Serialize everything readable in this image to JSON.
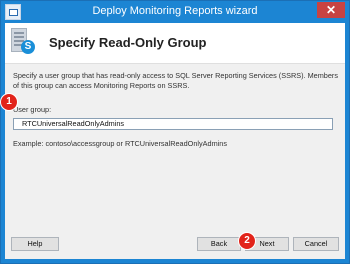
{
  "window": {
    "title": "Deploy Monitoring Reports wizard",
    "close_label": "✕"
  },
  "header": {
    "title": "Specify Read-Only Group"
  },
  "content": {
    "description": "Specify a user group that has read-only access to SQL Server Reporting Services (SSRS). Members of this group can access Monitoring Reports on SSRS.",
    "user_group_label": "User group:",
    "user_group_value": "RTCUniversalReadOnlyAdmins",
    "example_text": "Example: contoso\\accessgroup or RTCUniversalReadOnlyAdmins"
  },
  "buttons": {
    "help": "Help",
    "back": "Back",
    "next": "Next",
    "cancel": "Cancel"
  },
  "markers": {
    "m1": "1",
    "m2": "2"
  },
  "colors": {
    "title_bar": "#1c85d3",
    "close_button": "#c74342",
    "marker": "#e2231a"
  }
}
